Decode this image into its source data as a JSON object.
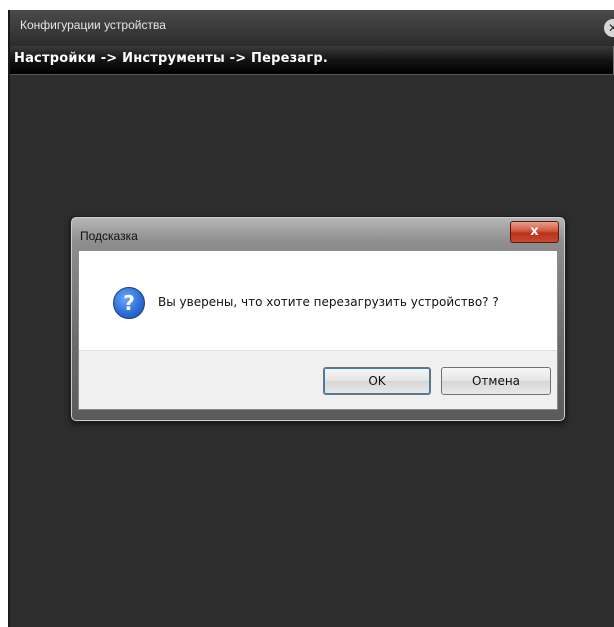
{
  "window": {
    "title": "Конфигурации устройства",
    "close_glyph": "✕"
  },
  "breadcrumb": {
    "text": "Настройки -> Инструменты -> Перезагр."
  },
  "dialog": {
    "title": "Подсказка",
    "close_glyph": "x",
    "icon": "question-icon",
    "icon_glyph": "?",
    "message": "Вы уверены, что хотите перезагрузить устройство? ?",
    "ok_label": "OK",
    "cancel_label": "Отмена"
  }
}
